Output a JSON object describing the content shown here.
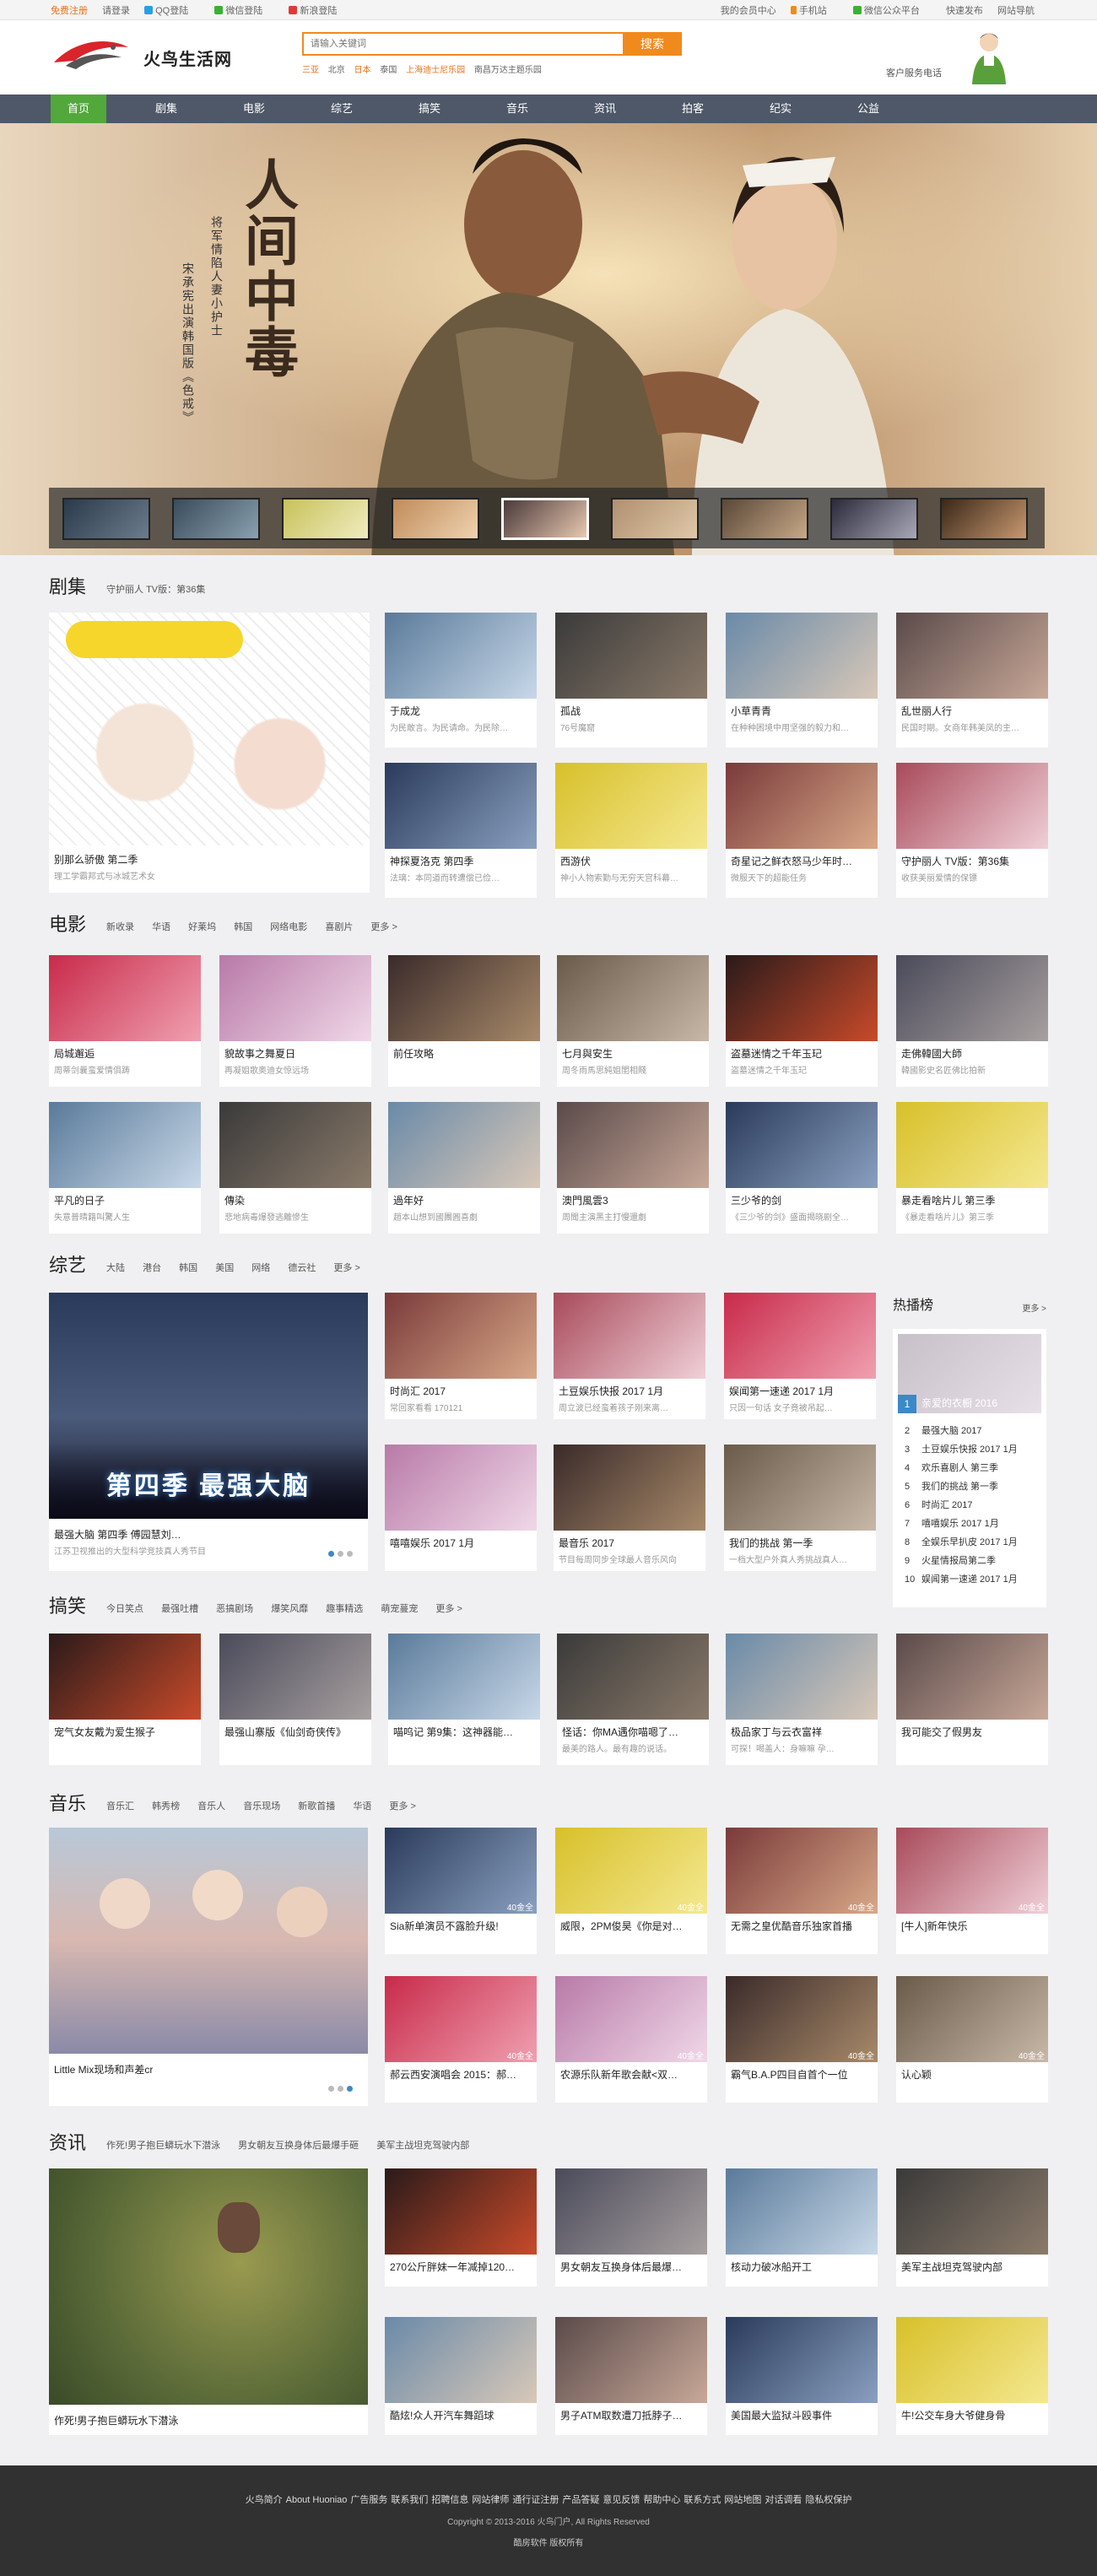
{
  "topbar": {
    "left": [
      "免费注册",
      "请登录",
      "QQ登陆",
      "微信登陆",
      "新浪登陆"
    ],
    "right": [
      "我的会员中心",
      "手机站",
      "微信公众平台",
      "快速发布",
      "网站导航"
    ]
  },
  "header": {
    "site_name": "火鸟生活网",
    "search_placeholder": "请输入关键词",
    "search_button": "搜索",
    "hot_words": [
      "三亚",
      "北京",
      "日本",
      "泰国",
      "上海迪士尼乐园",
      "南昌万达主题乐园"
    ],
    "service_label": "客户服务电话"
  },
  "nav": [
    "首页",
    "剧集",
    "电影",
    "综艺",
    "搞笑",
    "音乐",
    "资讯",
    "拍客",
    "纪实",
    "公益"
  ],
  "banner": {
    "title": "人间中毒",
    "sub1": "将军情陷人妻小护士",
    "sub2": "宋承宪出演韩国版《色戒》"
  },
  "dramas": {
    "title": "剧集",
    "tags": [
      "守护丽人 TV版：第36集"
    ],
    "big": {
      "title": "别那么骄傲 第二季",
      "desc": "理工学霸邦式与冰城艺术女"
    },
    "items": [
      {
        "title": "于成龙",
        "desc": "为民敢言。为民请命。为民除…"
      },
      {
        "title": "孤战",
        "desc": "76号魔窟"
      },
      {
        "title": "小草青青",
        "desc": "在种种困境中用坚强的毅力和…"
      },
      {
        "title": "乱世丽人行",
        "desc": "民国时期。女商年韩美凤的主…"
      },
      {
        "title": "神探夏洛克 第四季",
        "desc": "法璃：本同道而转遭偿已俭…"
      },
      {
        "title": "西游伏",
        "desc": "神小人物索勤与无穷天宫科幕…"
      },
      {
        "title": "奇星记之鲜衣怒马少年时…",
        "desc": "微服天下的超能任务"
      },
      {
        "title": "守护丽人 TV版：第36集",
        "desc": "收获美丽爱情的保镖"
      }
    ]
  },
  "movies": {
    "title": "电影",
    "tags": [
      "新收录",
      "华语",
      "好莱坞",
      "韩国",
      "网络电影",
      "喜剧片",
      "更多 >"
    ],
    "items": [
      {
        "title": "局城邂逅",
        "desc": "周蒂剑曩蛮爱情俱踌"
      },
      {
        "title": "貌故事之舞夏日",
        "desc": "再凝姐歌奥迪女惊远场"
      },
      {
        "title": "前任攻略",
        "desc": ""
      },
      {
        "title": "七月與安生",
        "desc": "周冬雨馬思純姐閨相賤"
      },
      {
        "title": "盗墓迷情之千年玉玘",
        "desc": "盗墓迷情之千年玉玘"
      },
      {
        "title": "走佛韓國大師",
        "desc": "韓國影史名匠佛比拍新"
      },
      {
        "title": "平凡的日子",
        "desc": "失意普晴籍叫驚人生"
      },
      {
        "title": "傳染",
        "desc": "悲地病毒爆發逃離慘生"
      },
      {
        "title": "過年好",
        "desc": "趙本山想到國團圓喜劇"
      },
      {
        "title": "澳門風雲3",
        "desc": "周聞主演黑主打慢還劇"
      },
      {
        "title": "三少爷的剑",
        "desc": "《三少爷的剑》盛面揭晓剧全…"
      },
      {
        "title": "暴走看啥片儿 第三季",
        "desc": "《暴走看啥片儿》第三季"
      }
    ]
  },
  "variety": {
    "title": "综艺",
    "tags": [
      "大陆",
      "港台",
      "韩国",
      "美国",
      "网络",
      "德云社",
      "更多 >"
    ],
    "big": {
      "title": "最强大脑 第四季 傅园慧刘…",
      "desc": "江苏卫视推出的大型科学竞技真人秀节目",
      "caption": "第四季 最强大脑"
    },
    "items": [
      {
        "title": "时尚汇 2017",
        "desc": "常回家看看 170121"
      },
      {
        "title": "土豆娱乐快报 2017 1月",
        "desc": "周立波已经蛮着孩子刚来离…"
      },
      {
        "title": "娱闻第一速递 2017 1月",
        "desc": "只因一句话 女子竟被吊起…"
      },
      {
        "title": "嘻嘻娱乐 2017 1月",
        "desc": ""
      },
      {
        "title": "最音乐 2017",
        "desc": "节目每周同步全球最人音乐风向"
      },
      {
        "title": "我们的挑战 第一季",
        "desc": "一档大型户外真人秀挑战真人…"
      }
    ]
  },
  "hot_rank": {
    "title": "热播榜",
    "more": "更多 >",
    "top_caption": "亲爱的衣橱 2016",
    "items": [
      "最强大脑 2017",
      "土豆娱乐快报 2017 1月",
      "欢乐喜剧人 第三季",
      "我们的挑战 第一季",
      "时尚汇 2017",
      "嘻嘻娱乐 2017 1月",
      "全娱乐早扒皮 2017 1月",
      "火星情报局第二季",
      "娱闻第一速递 2017 1月"
    ]
  },
  "funny": {
    "title": "搞笑",
    "tags": [
      "今日笑点",
      "最强吐槽",
      "恶搞剧场",
      "爆笑风靡",
      "趣事精选",
      "萌宠蔓宠",
      "更多 >"
    ],
    "items": [
      {
        "title": "宠气女友戴为爱生猴子",
        "desc": ""
      },
      {
        "title": "最强山寨版《仙剑奇侠传》",
        "desc": ""
      },
      {
        "title": "喵呜记 第9集：这神器能…",
        "desc": ""
      },
      {
        "title": "怪话：你MA遇你喵嗯了…",
        "desc": "最美的路人。最有趣的说话。"
      },
      {
        "title": "极品家丁与云衣富祥",
        "desc": "可探！喝盖人：身嘛嘛 孕…"
      },
      {
        "title": "我可能交了假男友",
        "desc": ""
      }
    ]
  },
  "music": {
    "title": "音乐",
    "tags": [
      "音乐汇",
      "韩秀榜",
      "音乐人",
      "音乐现场",
      "新歌首播",
      "华语",
      "更多 >"
    ],
    "big": {
      "title": "Little Mix现场和声差cr"
    },
    "badge": "40金全",
    "items": [
      {
        "title": "Sia新单演员不露脸升级!"
      },
      {
        "title": "威限，2PM俊昊《你是对…"
      },
      {
        "title": "无需之皇优酷音乐独家首播"
      },
      {
        "title": "[牛人]新年快乐"
      },
      {
        "title": "郝云西安演唱会 2015：郝…"
      },
      {
        "title": "农源乐队新年歌会献<双…"
      },
      {
        "title": "霸气B.A.P四目自首个一位"
      },
      {
        "title": "认心颖"
      }
    ]
  },
  "news": {
    "title": "资讯",
    "tags": [
      "作死!男子抱巨蟒玩水下潜泳",
      "男女朝友互换身体后最爆手砸",
      "美军主战坦克驾驶内部"
    ],
    "big": {
      "title": "作死!男子抱巨蟒玩水下潜泳"
    },
    "items": [
      {
        "title": "270公斤胖妹一年减掉120…"
      },
      {
        "title": "男女朝友互换身体后最爆…"
      },
      {
        "title": "核动力破冰船开工"
      },
      {
        "title": "美军主战坦克驾驶内部"
      },
      {
        "title": "酷炫!众人开汽车舞蹈球"
      },
      {
        "title": "男子ATM取数遭刀抵脖子…"
      },
      {
        "title": "美国最大监狱斗殴事件"
      },
      {
        "title": "牛!公交车身大爷健身骨"
      }
    ]
  },
  "footer": {
    "links": [
      "火鸟简介",
      "About Huoniao",
      "广告服务",
      "联系我们",
      "招聘信息",
      "网站律师",
      "通行证注册",
      "产品答疑",
      "意见反馈",
      "帮助中心",
      "联系方式",
      "网站地图",
      "对话调看",
      "隐私权保护"
    ],
    "copyright": "Copyright © 2013-2016 火鸟门户, All Rights Reserved",
    "extra": "酷房软件  版权所有"
  },
  "colors": {
    "accent": "#f08a1c",
    "nav_bg": "#4e5868",
    "nav_active": "#52a83b",
    "link_blue": "#3b89c7",
    "footer_bg": "#313131"
  }
}
